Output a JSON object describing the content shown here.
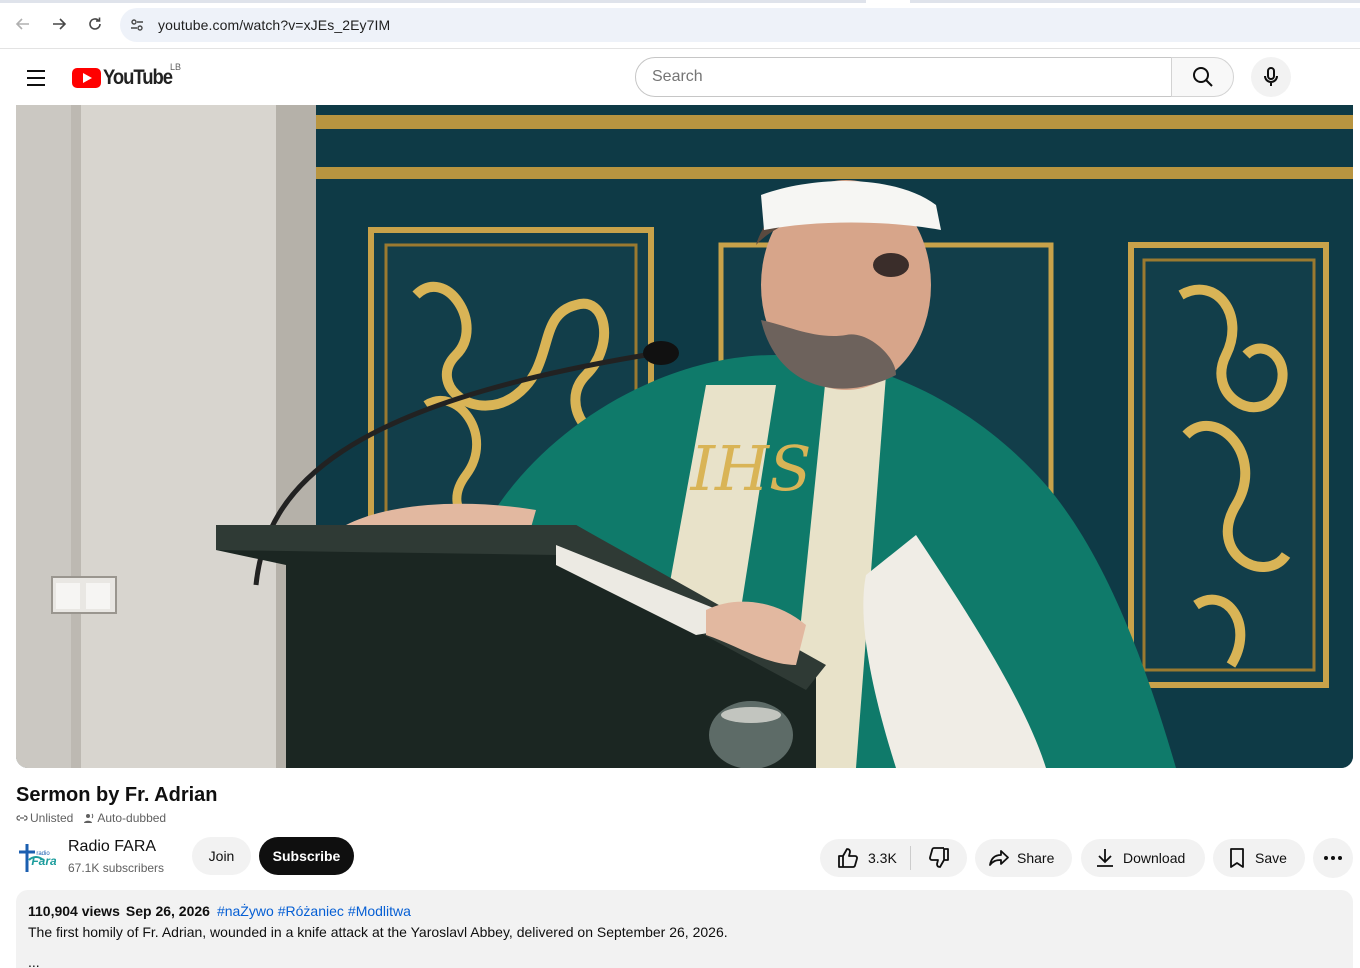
{
  "browser": {
    "url": "youtube.com/watch?v=xJEs_2Ey7IM"
  },
  "masthead": {
    "logo_text": "YouTube",
    "region": "LB",
    "search_placeholder": "Search"
  },
  "video": {
    "title": "Sermon by Fr. Adrian",
    "badges": [
      "Unlisted",
      "Auto-dubbed"
    ],
    "monogram": "IHS"
  },
  "channel": {
    "avatar_text": "Fara",
    "avatar_small": "radio",
    "name": "Radio FARA",
    "subscribers": "67.1K subscribers",
    "join_label": "Join",
    "subscribe_label": "Subscribe"
  },
  "actions": {
    "likes": "3.3K",
    "share_label": "Share",
    "download_label": "Download",
    "save_label": "Save"
  },
  "description": {
    "views": "110,904 views",
    "date": "Sep 26, 2026",
    "hashtags": [
      "#naŻywo",
      "#Różaniec",
      "#Modlitwa"
    ],
    "text": "The first homily of Fr. Adrian, wounded in a knife attack at the Yaroslavl Abbey, delivered on September 26, 2026.",
    "more": "..."
  },
  "colors": {
    "brand_red": "#ff0000",
    "link_blue": "#065fd4",
    "vestment_green": "#0f7a6a",
    "panel_teal": "#0e3a46",
    "gold": "#c8a24a"
  }
}
